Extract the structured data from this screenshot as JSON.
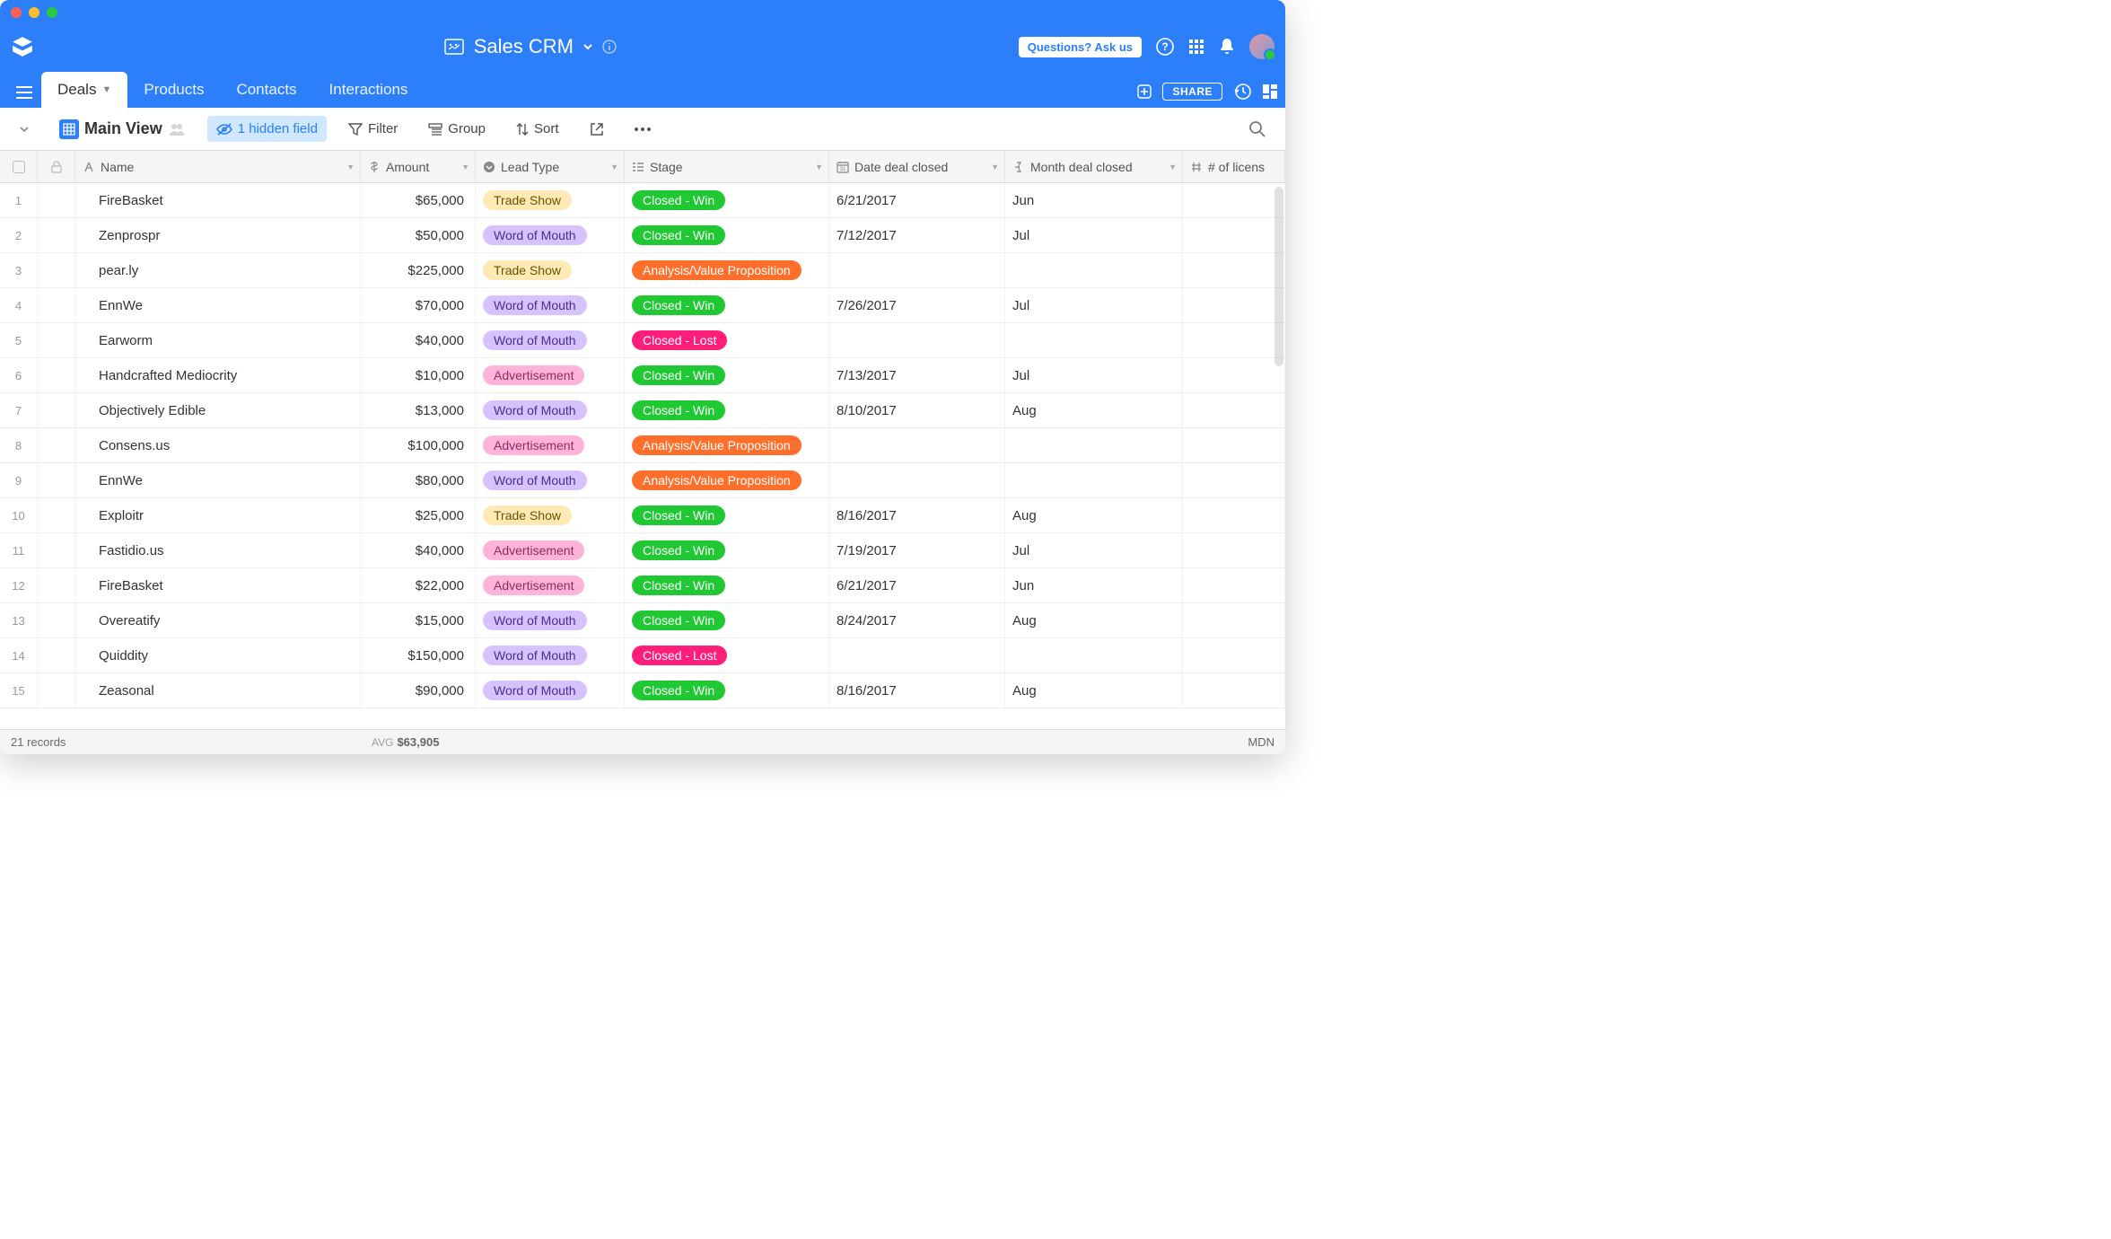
{
  "app": {
    "title": "Sales CRM"
  },
  "topbar": {
    "ask_label": "Questions? Ask us"
  },
  "tabs": {
    "items": [
      "Deals",
      "Products",
      "Contacts",
      "Interactions"
    ],
    "active": 0,
    "share_label": "SHARE"
  },
  "toolbar": {
    "view_name": "Main View",
    "hidden_fields": "1 hidden field",
    "filter": "Filter",
    "group": "Group",
    "sort": "Sort"
  },
  "columns": {
    "name": "Name",
    "amount": "Amount",
    "lead": "Lead Type",
    "stage": "Stage",
    "date": "Date deal closed",
    "month": "Month deal closed",
    "lic": "# of licens"
  },
  "pill_labels": {
    "trade": "Trade Show",
    "wom": "Word of Mouth",
    "adv": "Advertisement",
    "win": "Closed - Win",
    "lost": "Closed - Lost",
    "avp": "Analysis/Value Proposition"
  },
  "rows": [
    {
      "name": "FireBasket",
      "amount": "$65,000",
      "lead": "trade",
      "stage": "win",
      "date": "6/21/2017",
      "month": "Jun"
    },
    {
      "name": "Zenprospr",
      "amount": "$50,000",
      "lead": "wom",
      "stage": "win",
      "date": "7/12/2017",
      "month": "Jul"
    },
    {
      "name": "pear.ly",
      "amount": "$225,000",
      "lead": "trade",
      "stage": "avp",
      "date": "",
      "month": ""
    },
    {
      "name": "EnnWe",
      "amount": "$70,000",
      "lead": "wom",
      "stage": "win",
      "date": "7/26/2017",
      "month": "Jul"
    },
    {
      "name": "Earworm",
      "amount": "$40,000",
      "lead": "wom",
      "stage": "lost",
      "date": "",
      "month": ""
    },
    {
      "name": "Handcrafted Mediocrity",
      "amount": "$10,000",
      "lead": "adv",
      "stage": "win",
      "date": "7/13/2017",
      "month": "Jul"
    },
    {
      "name": "Objectively Edible",
      "amount": "$13,000",
      "lead": "wom",
      "stage": "win",
      "date": "8/10/2017",
      "month": "Aug"
    },
    {
      "name": "Consens.us",
      "amount": "$100,000",
      "lead": "adv",
      "stage": "avp",
      "date": "",
      "month": ""
    },
    {
      "name": "EnnWe",
      "amount": "$80,000",
      "lead": "wom",
      "stage": "avp",
      "date": "",
      "month": ""
    },
    {
      "name": "Exploitr",
      "amount": "$25,000",
      "lead": "trade",
      "stage": "win",
      "date": "8/16/2017",
      "month": "Aug"
    },
    {
      "name": "Fastidio.us",
      "amount": "$40,000",
      "lead": "adv",
      "stage": "win",
      "date": "7/19/2017",
      "month": "Jul"
    },
    {
      "name": "FireBasket",
      "amount": "$22,000",
      "lead": "adv",
      "stage": "win",
      "date": "6/21/2017",
      "month": "Jun"
    },
    {
      "name": "Overeatify",
      "amount": "$15,000",
      "lead": "wom",
      "stage": "win",
      "date": "8/24/2017",
      "month": "Aug"
    },
    {
      "name": "Quiddity",
      "amount": "$150,000",
      "lead": "wom",
      "stage": "lost",
      "date": "",
      "month": ""
    },
    {
      "name": "Zeasonal",
      "amount": "$90,000",
      "lead": "wom",
      "stage": "win",
      "date": "8/16/2017",
      "month": "Aug"
    }
  ],
  "footer": {
    "records": "21 records",
    "avg_label": "AVG",
    "avg_value": "$63,905",
    "mdn": "MDN"
  }
}
